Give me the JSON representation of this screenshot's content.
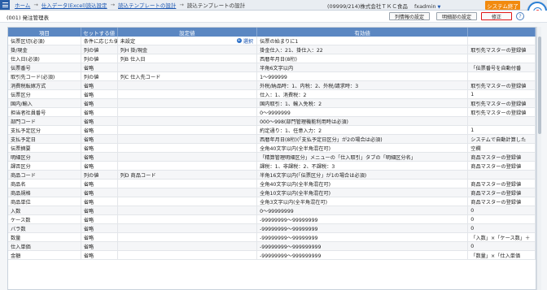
{
  "breadcrumb": {
    "home": "ホーム",
    "level1": "仕入データ(Excel)読込設定",
    "level2": "読込テンプレートの設計",
    "current": "読込テンプレートの設計"
  },
  "user": {
    "company": "(09999/214)株式会社ＴＫＣ食品",
    "name": "fxadmin"
  },
  "buttons": {
    "system_exit": "システム終了",
    "list_settings": "列情報の設定",
    "detail_settings": "明細部の設定",
    "edit": "修正",
    "help": "?"
  },
  "page_title": "(001) 発注管理表",
  "table": {
    "headers": [
      "項目",
      "セットする値",
      "設定値",
      "有効値",
      ""
    ],
    "ref_label": "選択",
    "rows": [
      [
        "伝票区切(必須)",
        "条件に応じた値",
        "未設定",
        "伝票の始まりに1",
        ""
      ],
      [
        "掛/現金",
        "列の値",
        "列H 掛/現金",
        "掛金仕入：21、掛仕入：22",
        "取引先マスターの登録値"
      ],
      [
        "仕入日(必須)",
        "列の値",
        "列B 仕入日",
        "西暦年月日(8桁)",
        ""
      ],
      [
        "伝票番号",
        "省略",
        "",
        "半角6文字以内",
        "「伝票番号を自動付番"
      ],
      [
        "取引先コード(必須)",
        "列の値",
        "列C 仕入先コード",
        "1～999999",
        ""
      ],
      [
        "消費税転嫁方式",
        "省略",
        "",
        "外税/納品時：1、内税：2、外税/請求時：3",
        "取引先マスターの登録値"
      ],
      [
        "伝票区分",
        "省略",
        "",
        "仕入：1、消費税：2",
        "1"
      ],
      [
        "国内/輸入",
        "省略",
        "",
        "国内取引：1、輸入免税：2",
        "取引先マスターの登録値"
      ],
      [
        "担当者社員番号",
        "省略",
        "",
        "0～9999999",
        "取引先マスターの登録値"
      ],
      [
        "部門コード",
        "省略",
        "",
        "000～998(部門管理機能利用時は必須)",
        ""
      ],
      [
        "支払予定区分",
        "省略",
        "",
        "約定通り：1、任意入力：2",
        "1"
      ],
      [
        "支払予定日",
        "省略",
        "",
        "西暦年月日(8桁)(「支払予定日区分」が2の場合は必須)",
        "システムで自動計算した"
      ],
      [
        "伝票摘要",
        "省略",
        "",
        "全角40文字以内(全半角混在可)",
        "空欄"
      ],
      [
        "明細区分",
        "省略",
        "",
        "「精算管理明細区分」メニューの「仕入取引」タブの「明細区分名」",
        "商品マスターの登録値"
      ],
      [
        "課否区分",
        "省略",
        "",
        "課税：1、非課税：2、不課税：3",
        "商品マスターの登録値"
      ],
      [
        "商品コード",
        "列の値",
        "列D 商品コード",
        "半角16文字以内(「伝票区分」が1の場合は必須)",
        ""
      ],
      [
        "商品名",
        "省略",
        "",
        "全角40文字以内(全半角混在可)",
        "商品マスターの登録値"
      ],
      [
        "商品規格",
        "省略",
        "",
        "全角10文字以内(全半角混在可)",
        "商品マスターの登録値"
      ],
      [
        "商品単位",
        "省略",
        "",
        "全角3文字以内(全半角混在可)",
        "商品マスターの登録値"
      ],
      [
        "入数",
        "省略",
        "",
        "0～99999999",
        "0"
      ],
      [
        "ケース数",
        "省略",
        "",
        "-99999999～99999999",
        "0"
      ],
      [
        "バラ数",
        "省略",
        "",
        "-99999999～99999999",
        "0"
      ],
      [
        "数量",
        "省略",
        "",
        "-99999999～99999999",
        "「入数」×「ケース数」＋"
      ],
      [
        "仕入単価",
        "省略",
        "",
        "-99999999～999999999",
        "0"
      ],
      [
        "金額",
        "省略",
        "",
        "-99999999～999999999",
        "「数量」×「仕入単価"
      ]
    ]
  }
}
